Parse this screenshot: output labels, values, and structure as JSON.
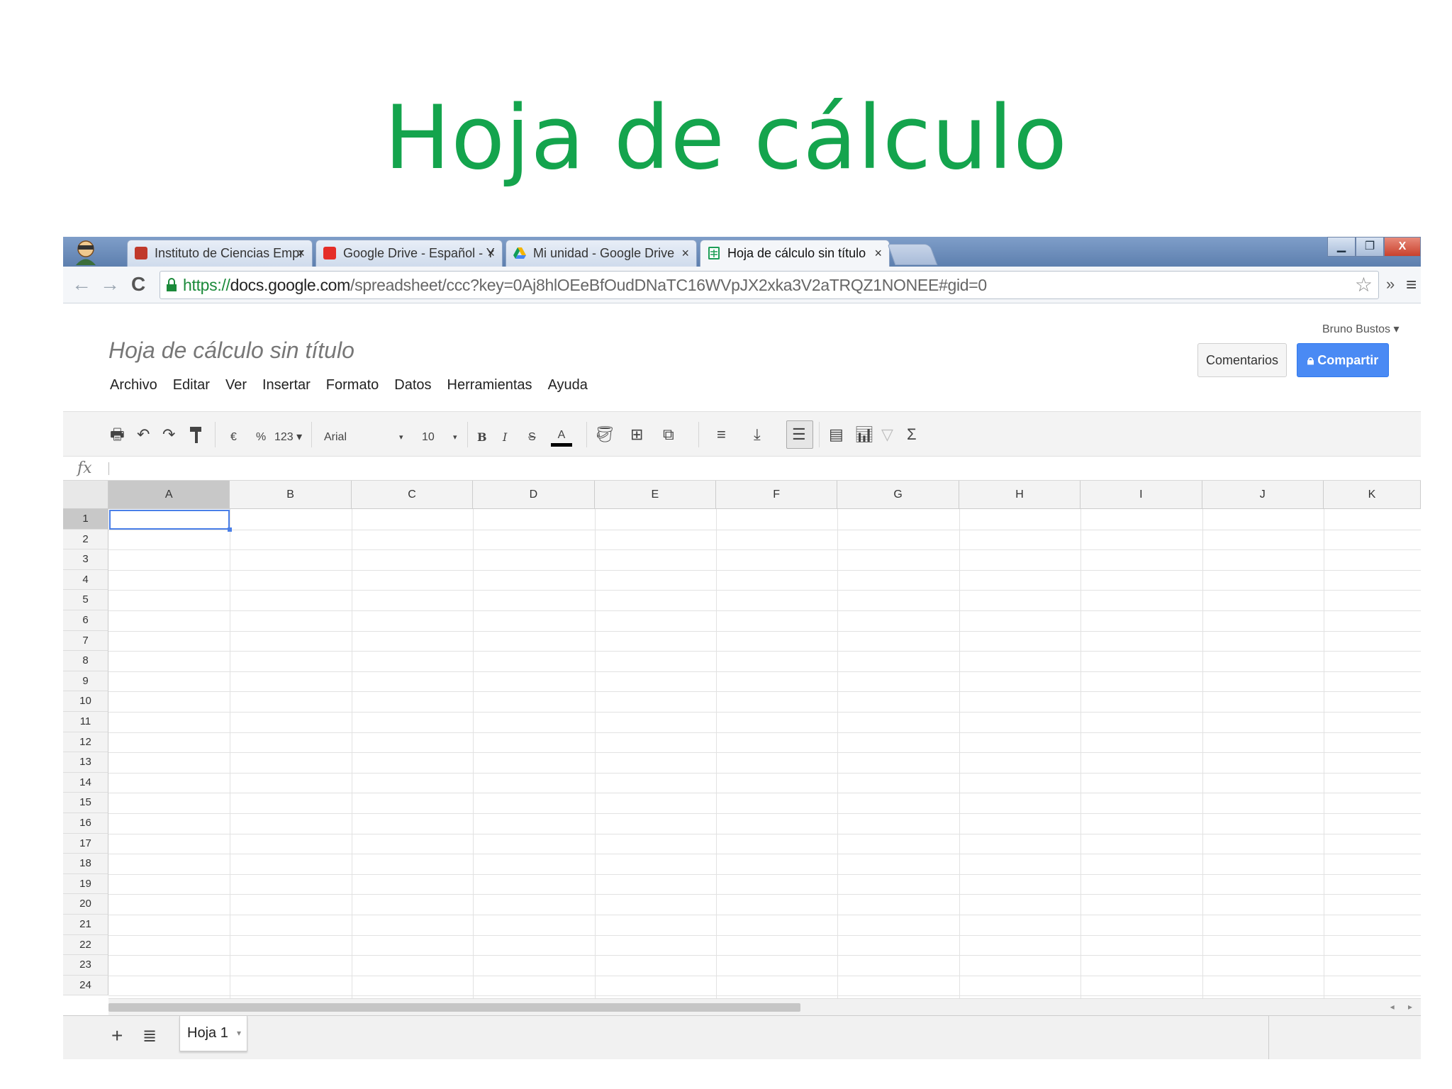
{
  "slide": {
    "title": "Hoja de cálculo"
  },
  "browser": {
    "tabs": [
      {
        "label": "Instituto de Ciencias Empr",
        "color": "#c0392b"
      },
      {
        "label": "Google Drive - Español - Y",
        "color": "#e52d27"
      },
      {
        "label": "Mi unidad - Google Drive",
        "color": "#2da94f"
      },
      {
        "label": "Hoja de cálculo sin título",
        "color": "#1e9e57",
        "active": true
      }
    ],
    "tab_close": "×",
    "url": {
      "scheme": "https://",
      "host": "docs.google.com",
      "path": "/spreadsheet/ccc?key=0Aj8hlOEeBfOudDNaTC16WVpJX2xka3V2aTRQZ1NONEE#gid=0"
    },
    "window_controls": {
      "minimize": "▁",
      "restore": "❐",
      "close": "X"
    },
    "icons": {
      "back": "←",
      "forward": "→",
      "reload": "C",
      "star": "☆",
      "overflow": "»",
      "menu": "≡"
    }
  },
  "docs": {
    "user": "Bruno Bustos ▾",
    "title": "Hoja de cálculo sin título",
    "comments_label": "Comentarios",
    "share_label": "Compartir",
    "menu": [
      "Archivo",
      "Editar",
      "Ver",
      "Insertar",
      "Formato",
      "Datos",
      "Herramientas",
      "Ayuda"
    ],
    "toolbar": {
      "currency": "€",
      "percent": "%",
      "number_format": "123 ▾",
      "font": "Arial",
      "font_size": "10",
      "bold": "B",
      "italic": "I",
      "strike": "S",
      "text_color": "A",
      "sum": "Σ"
    },
    "fx_label": "fx",
    "columns": [
      "A",
      "B",
      "C",
      "D",
      "E",
      "F",
      "G",
      "H",
      "I",
      "J",
      "K"
    ],
    "rows": [
      "1",
      "2",
      "3",
      "4",
      "5",
      "6",
      "7",
      "8",
      "9",
      "10",
      "11",
      "12",
      "13",
      "14",
      "15",
      "16",
      "17",
      "18",
      "19",
      "20",
      "21",
      "22",
      "23",
      "24"
    ],
    "selected_cell": "A1",
    "sheet_add": "+",
    "sheet_list": "≣",
    "sheet_tab": "Hoja 1",
    "scroll_arrows": "◂ ▸"
  },
  "colors": {
    "title_green": "#14a44d",
    "share_blue": "#4a8af4",
    "selection_blue": "#4a7fe8"
  }
}
